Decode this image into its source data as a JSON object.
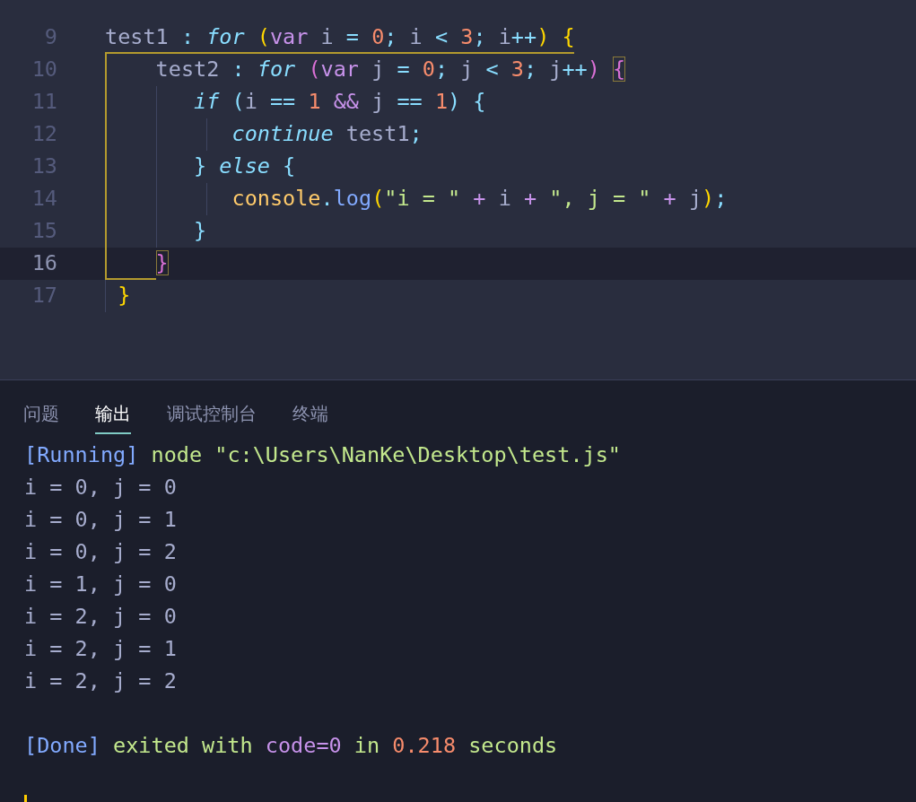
{
  "editor": {
    "lines": [
      {
        "number": "9",
        "current": false,
        "scope": false,
        "tokens": [
          {
            "text": "test1",
            "kind": "plain"
          },
          {
            "text": " : ",
            "kind": "punct"
          },
          {
            "text": "for ",
            "kind": "keyword"
          },
          {
            "text": "(",
            "kind": "bracket1"
          },
          {
            "text": "var",
            "kind": "storage"
          },
          {
            "text": " i ",
            "kind": "plain"
          },
          {
            "text": "= ",
            "kind": "punct"
          },
          {
            "text": "0",
            "kind": "number"
          },
          {
            "text": ";",
            "kind": "punct"
          },
          {
            "text": " i ",
            "kind": "plain"
          },
          {
            "text": "< ",
            "kind": "punct"
          },
          {
            "text": "3",
            "kind": "number"
          },
          {
            "text": ";",
            "kind": "punct"
          },
          {
            "text": " i",
            "kind": "plain"
          },
          {
            "text": "++",
            "kind": "punct"
          },
          {
            "text": ") {",
            "kind": "bracket1"
          }
        ]
      },
      {
        "number": "10",
        "current": false,
        "scope": true,
        "tokens": [
          {
            "text": "    test2",
            "kind": "plain"
          },
          {
            "text": " : ",
            "kind": "punct"
          },
          {
            "text": "for ",
            "kind": "keyword"
          },
          {
            "text": "(",
            "kind": "bracket2"
          },
          {
            "text": "var",
            "kind": "storage"
          },
          {
            "text": " j ",
            "kind": "plain"
          },
          {
            "text": "= ",
            "kind": "punct"
          },
          {
            "text": "0",
            "kind": "number"
          },
          {
            "text": ";",
            "kind": "punct"
          },
          {
            "text": " j ",
            "kind": "plain"
          },
          {
            "text": "< ",
            "kind": "punct"
          },
          {
            "text": "3",
            "kind": "number"
          },
          {
            "text": ";",
            "kind": "punct"
          },
          {
            "text": " j",
            "kind": "plain"
          },
          {
            "text": "++",
            "kind": "punct"
          },
          {
            "text": ") ",
            "kind": "bracket2"
          },
          {
            "text": "{",
            "kind": "bracket2",
            "matched": true
          }
        ]
      },
      {
        "number": "11",
        "current": false,
        "scope": true,
        "tokens": [
          {
            "text": "       if ",
            "kind": "keyword"
          },
          {
            "text": "(",
            "kind": "bracket3"
          },
          {
            "text": "i ",
            "kind": "plain"
          },
          {
            "text": "== ",
            "kind": "punct"
          },
          {
            "text": "1 ",
            "kind": "number"
          },
          {
            "text": "&& ",
            "kind": "storage"
          },
          {
            "text": "j ",
            "kind": "plain"
          },
          {
            "text": "== ",
            "kind": "punct"
          },
          {
            "text": "1",
            "kind": "number"
          },
          {
            "text": ") {",
            "kind": "bracket3"
          }
        ]
      },
      {
        "number": "12",
        "current": false,
        "scope": true,
        "tokens": [
          {
            "text": "          continue",
            "kind": "keyword"
          },
          {
            "text": " test1",
            "kind": "plain"
          },
          {
            "text": ";",
            "kind": "punct"
          }
        ]
      },
      {
        "number": "13",
        "current": false,
        "scope": true,
        "tokens": [
          {
            "text": "       } ",
            "kind": "bracket3"
          },
          {
            "text": "else ",
            "kind": "keyword"
          },
          {
            "text": "{",
            "kind": "bracket3"
          }
        ]
      },
      {
        "number": "14",
        "current": false,
        "scope": true,
        "tokens": [
          {
            "text": "          console",
            "kind": "object"
          },
          {
            "text": ".",
            "kind": "punct"
          },
          {
            "text": "log",
            "kind": "function"
          },
          {
            "text": "(",
            "kind": "bracket1"
          },
          {
            "text": "\"i = \" ",
            "kind": "string"
          },
          {
            "text": "+",
            "kind": "storage"
          },
          {
            "text": " i ",
            "kind": "plain"
          },
          {
            "text": "+ ",
            "kind": "storage"
          },
          {
            "text": "\", j = \" ",
            "kind": "string"
          },
          {
            "text": "+",
            "kind": "storage"
          },
          {
            "text": " j",
            "kind": "plain"
          },
          {
            "text": ")",
            "kind": "bracket1"
          },
          {
            "text": ";",
            "kind": "punct"
          }
        ]
      },
      {
        "number": "15",
        "current": false,
        "scope": true,
        "tokens": [
          {
            "text": "       }",
            "kind": "bracket3"
          }
        ]
      },
      {
        "number": "16",
        "current": true,
        "scope": true,
        "tokens": [
          {
            "text": "    }",
            "kind": "bracket2",
            "matched": true
          }
        ]
      },
      {
        "number": "17",
        "current": false,
        "scope": false,
        "tokens": [
          {
            "text": " }",
            "kind": "bracket1"
          }
        ]
      }
    ]
  },
  "panel": {
    "tabs": [
      {
        "label": "问题",
        "selected": false
      },
      {
        "label": "输出",
        "selected": true
      },
      {
        "label": "调试控制台",
        "selected": false
      },
      {
        "label": "终端",
        "selected": false
      }
    ],
    "output": [
      {
        "kind": "header",
        "segments": [
          {
            "text": "[Running]",
            "kind": "tag"
          },
          {
            "text": " node \"c:\\Users\\NanKe\\Desktop\\test.js\"",
            "kind": "info"
          }
        ]
      },
      {
        "kind": "result",
        "segments": [
          {
            "text": "i = 0, j = 0",
            "kind": "plain"
          }
        ]
      },
      {
        "kind": "result",
        "segments": [
          {
            "text": "i = 0, j = 1",
            "kind": "plain"
          }
        ]
      },
      {
        "kind": "result",
        "segments": [
          {
            "text": "i = 0, j = 2",
            "kind": "plain"
          }
        ]
      },
      {
        "kind": "result",
        "segments": [
          {
            "text": "i = 1, j = 0",
            "kind": "plain"
          }
        ]
      },
      {
        "kind": "result",
        "segments": [
          {
            "text": "i = 2, j = 0",
            "kind": "plain"
          }
        ]
      },
      {
        "kind": "result",
        "segments": [
          {
            "text": "i = 2, j = 1",
            "kind": "plain"
          }
        ]
      },
      {
        "kind": "result",
        "segments": [
          {
            "text": "i = 2, j = 2",
            "kind": "plain"
          }
        ]
      },
      {
        "kind": "summary",
        "segments": [
          {
            "text": "[Done]",
            "kind": "tag"
          },
          {
            "text": " exited with ",
            "kind": "info"
          },
          {
            "text": "code=0",
            "kind": "code"
          },
          {
            "text": " in ",
            "kind": "info"
          },
          {
            "text": "0.218",
            "kind": "time"
          },
          {
            "text": " seconds",
            "kind": "info"
          }
        ]
      }
    ]
  }
}
